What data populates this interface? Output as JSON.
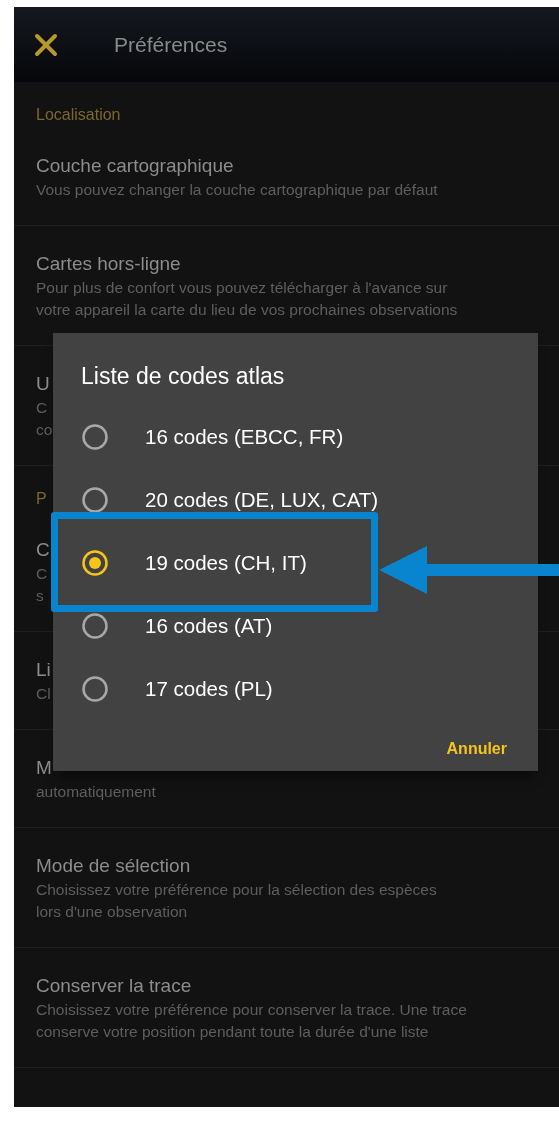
{
  "app_bar": {
    "title": "Préférences"
  },
  "settings": [
    {
      "kind": "category",
      "title": "Localisation"
    },
    {
      "kind": "setting",
      "title": "Couche cartographique",
      "description_lines": [
        "Vous pouvez changer la couche cartographique par défaut"
      ]
    },
    {
      "kind": "setting",
      "title": "Cartes hors-ligne",
      "description_lines": [
        "Pour plus de confort vous pouvez télécharger à l'avance sur",
        "votre appareil la carte du lieu de vos prochaines observations"
      ]
    },
    {
      "kind": "setting",
      "title": "U",
      "description_lines": [
        "C",
        "co"
      ]
    },
    {
      "kind": "category",
      "title": "P"
    },
    {
      "kind": "setting",
      "title": "C",
      "description_lines": [
        "C",
        "s"
      ]
    },
    {
      "kind": "setting",
      "title": "Li",
      "description_lines": [
        "Cl"
      ]
    },
    {
      "kind": "setting",
      "title": "M",
      "description_lines": [
        "automatiquement"
      ]
    },
    {
      "kind": "setting",
      "title": "Mode de sélection",
      "description_lines": [
        "Choisissez votre préférence pour la sélection des espèces",
        "lors d'une observation"
      ]
    },
    {
      "kind": "setting",
      "title": "Conserver la trace",
      "description_lines": [
        "Choisissez votre préférence pour conserver la trace. Une trace",
        "conserve votre position pendant toute la durée d'une liste"
      ]
    }
  ],
  "dialog": {
    "title": "Liste de codes atlas",
    "options": [
      {
        "label": "16 codes (EBCC, FR)",
        "selected": false
      },
      {
        "label": "20 codes (DE, LUX, CAT)",
        "selected": false
      },
      {
        "label": "19 codes (CH, IT)",
        "selected": true
      },
      {
        "label": "16 codes (AT)",
        "selected": false
      },
      {
        "label": "17 codes (PL)",
        "selected": false
      }
    ],
    "cancel": "Annuler"
  }
}
